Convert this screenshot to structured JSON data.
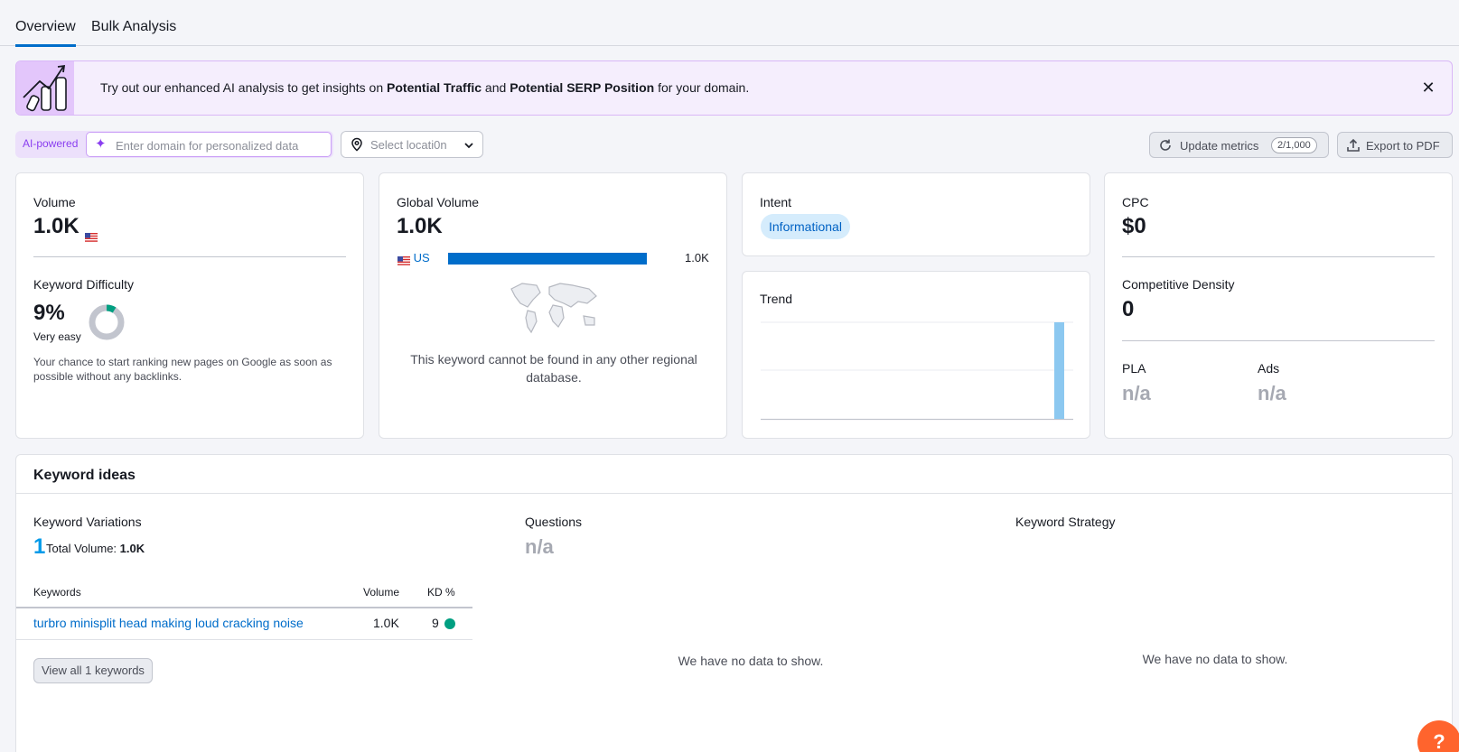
{
  "tabs": [
    {
      "label": "Overview",
      "active": true
    },
    {
      "label": "Bulk Analysis",
      "active": false
    }
  ],
  "banner": {
    "text_1": "Try out our enhanced AI analysis to get insights on ",
    "bold_1": "Potential Traffic",
    "text_2": " and ",
    "bold_2": "Potential SERP Position",
    "text_3": " for your domain.",
    "close_icon": "close-icon"
  },
  "controls": {
    "ai_label": "AI-powered",
    "domain_placeholder": "Enter domain for personalized data",
    "location_placeholder": "Select locati0n",
    "update_label": "Update metrics",
    "update_badge": "2/1,000",
    "export_label": "Export to PDF"
  },
  "volume_card": {
    "label": "Volume",
    "value": "1.0K",
    "kd_label": "Keyword Difficulty",
    "kd_value": "9%",
    "kd_level": "Very easy",
    "kd_percent": 9,
    "kd_note": "Your chance to start ranking new pages on Google as soon as possible without any backlinks."
  },
  "global_card": {
    "label": "Global Volume",
    "value": "1.0K",
    "country": "US",
    "country_value": "1.0K",
    "country_share": 1.0,
    "note": "This keyword cannot be found in any other regional database."
  },
  "intent_card": {
    "label": "Intent",
    "badge": "Informational"
  },
  "trend_card": {
    "label": "Trend",
    "values": [
      0,
      0,
      0,
      0,
      0,
      0,
      0,
      0,
      0,
      0,
      0,
      1
    ]
  },
  "cpc_card": {
    "label": "CPC",
    "value": "$0",
    "cd_label": "Competitive Density",
    "cd_value": "0",
    "pla_label": "PLA",
    "pla_value": "n/a",
    "ads_label": "Ads",
    "ads_value": "n/a"
  },
  "ideas": {
    "title": "Keyword ideas",
    "variations_label": "Keyword Variations",
    "variations_count": "1",
    "total_volume_label": "Total Volume: ",
    "total_volume_value": "1.0K",
    "columns": [
      "Keywords",
      "Volume",
      "KD %"
    ],
    "rows": [
      {
        "keyword": "turbro minisplit head making loud cracking noise",
        "volume": "1.0K",
        "kd": "9"
      }
    ],
    "view_all": "View all 1 keywords",
    "questions_label": "Questions",
    "questions_value": "n/a",
    "questions_empty": "We have no data to show.",
    "strategy_label": "Keyword Strategy",
    "strategy_empty": "We have no data to show."
  },
  "help_label": "?",
  "colors": {
    "accent": "#006dca",
    "ai_purple": "#8a3ef0",
    "kd_green": "#009f81",
    "trend_bar": "#8cc8f0",
    "help_orange": "#ff642d"
  }
}
